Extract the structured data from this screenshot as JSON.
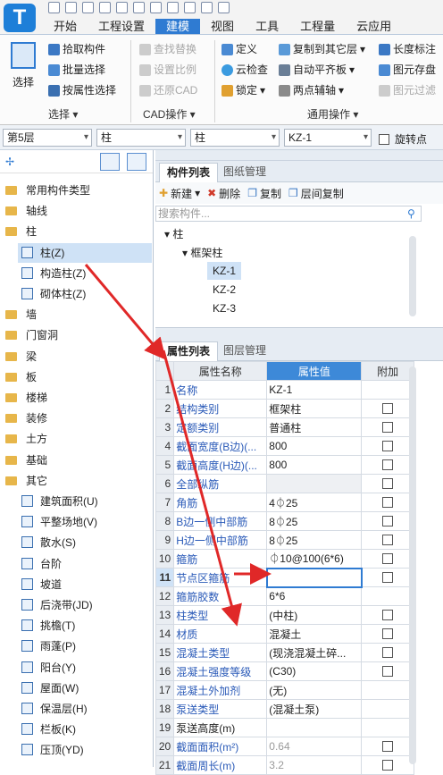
{
  "app": {
    "logo": "T"
  },
  "menu": {
    "tabs": [
      "开始",
      "工程设置",
      "建模",
      "视图",
      "工具",
      "工程量",
      "云应用"
    ],
    "active_index": 2
  },
  "ribbon": {
    "select_big": "选择",
    "select_items": [
      "拾取构件",
      "批量选择",
      "按属性选择"
    ],
    "cad_items": [
      "查找替换",
      "设置比例",
      "还原CAD"
    ],
    "ops_col1": [
      "定义",
      "云检查",
      "锁定"
    ],
    "ops_col2": [
      "复制到其它层",
      "自动平齐板",
      "两点辅轴"
    ],
    "ops_col3": [
      "长度标注",
      "图元存盘",
      "图元过滤"
    ],
    "groups": [
      "选择",
      "CAD操作",
      "通用操作"
    ]
  },
  "combos": {
    "floor": "第5层",
    "type": "柱",
    "subtype": "柱",
    "item": "KZ-1",
    "rotate_label": "旋转点"
  },
  "tree": {
    "items": [
      {
        "label": "常用构件类型",
        "kind": "folder"
      },
      {
        "label": "轴线",
        "kind": "folder"
      },
      {
        "label": "柱",
        "kind": "folder"
      },
      {
        "label": "柱(Z)",
        "kind": "child",
        "selected": true
      },
      {
        "label": "构造柱(Z)",
        "kind": "child"
      },
      {
        "label": "砌体柱(Z)",
        "kind": "child"
      },
      {
        "label": "墙",
        "kind": "folder"
      },
      {
        "label": "门窗洞",
        "kind": "folder"
      },
      {
        "label": "梁",
        "kind": "folder"
      },
      {
        "label": "板",
        "kind": "folder"
      },
      {
        "label": "楼梯",
        "kind": "folder"
      },
      {
        "label": "装修",
        "kind": "folder"
      },
      {
        "label": "土方",
        "kind": "folder"
      },
      {
        "label": "基础",
        "kind": "folder"
      },
      {
        "label": "其它",
        "kind": "folder"
      },
      {
        "label": "建筑面积(U)",
        "kind": "child"
      },
      {
        "label": "平整场地(V)",
        "kind": "child"
      },
      {
        "label": "散水(S)",
        "kind": "child"
      },
      {
        "label": "台阶",
        "kind": "child"
      },
      {
        "label": "坡道",
        "kind": "child"
      },
      {
        "label": "后浇带(JD)",
        "kind": "child"
      },
      {
        "label": "挑檐(T)",
        "kind": "child"
      },
      {
        "label": "雨蓬(P)",
        "kind": "child"
      },
      {
        "label": "阳台(Y)",
        "kind": "child"
      },
      {
        "label": "屋面(W)",
        "kind": "child"
      },
      {
        "label": "保温层(H)",
        "kind": "child"
      },
      {
        "label": "栏板(K)",
        "kind": "child"
      },
      {
        "label": "压顶(YD)",
        "kind": "child"
      }
    ]
  },
  "component_panel": {
    "tabs": [
      "构件列表",
      "图纸管理"
    ],
    "toolbar": [
      "新建",
      "删除",
      "复制",
      "层间复制"
    ],
    "search_placeholder": "搜索构件...",
    "nodes": [
      "柱",
      "框架柱",
      "KZ-1",
      "KZ-2",
      "KZ-3"
    ]
  },
  "property_panel": {
    "tabs": [
      "属性列表",
      "图层管理"
    ],
    "headers": [
      "属性名称",
      "属性值",
      "附加"
    ],
    "rows": [
      {
        "n": "1",
        "name": "名称",
        "value": "KZ-1",
        "check": false
      },
      {
        "n": "2",
        "name": "结构类别",
        "value": "框架柱",
        "check": true
      },
      {
        "n": "3",
        "name": "定额类别",
        "value": "普通柱",
        "check": true
      },
      {
        "n": "4",
        "name": "截面宽度(B边)(...",
        "value": "800",
        "check": true
      },
      {
        "n": "5",
        "name": "截面高度(H边)(...",
        "value": "800",
        "check": true
      },
      {
        "n": "6",
        "name": "全部纵筋",
        "value": "",
        "check": true
      },
      {
        "n": "7",
        "name": "角筋",
        "value": "4⏀25",
        "check": true
      },
      {
        "n": "8",
        "name": "B边一侧中部筋",
        "value": "8⏀25",
        "check": true
      },
      {
        "n": "9",
        "name": "H边一侧中部筋",
        "value": "8⏀25",
        "check": true
      },
      {
        "n": "10",
        "name": "箍筋",
        "value": "⏀10@100(6*6)",
        "check": true
      },
      {
        "n": "11",
        "name": "节点区箍筋",
        "value": "",
        "check": true,
        "editing": true
      },
      {
        "n": "12",
        "name": "箍筋胶数",
        "value": "6*6",
        "check": false
      },
      {
        "n": "13",
        "name": "柱类型",
        "value": "(中柱)",
        "check": true
      },
      {
        "n": "14",
        "name": "材质",
        "value": "混凝土",
        "check": true
      },
      {
        "n": "15",
        "name": "混凝土类型",
        "value": "(现浇混凝土碎...",
        "check": true
      },
      {
        "n": "16",
        "name": "混凝土强度等级",
        "value": "(C30)",
        "check": true
      },
      {
        "n": "17",
        "name": "混凝土外加剂",
        "value": "(无)",
        "check": false
      },
      {
        "n": "18",
        "name": "泵送类型",
        "value": "(混凝土泵)",
        "check": false
      },
      {
        "n": "19",
        "name": "泵送高度(m)",
        "value": "",
        "check": false
      },
      {
        "n": "20",
        "name": "截面面积(m²)",
        "value": "0.64",
        "check": true
      },
      {
        "n": "21",
        "name": "截面周长(m)",
        "value": "3.2",
        "check": true
      }
    ]
  }
}
